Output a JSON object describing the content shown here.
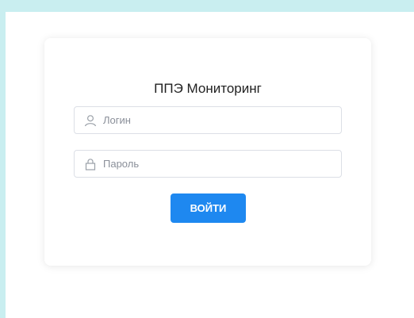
{
  "login_form": {
    "title": "ППЭ Мониторинг",
    "login_placeholder": "Логин",
    "password_placeholder": "Пароль",
    "submit_label": "ВОЙТИ"
  },
  "colors": {
    "page_background": "#c9eef0",
    "accent": "#1e88f0"
  },
  "icons": {
    "login": "user-icon",
    "password": "lock-icon"
  }
}
